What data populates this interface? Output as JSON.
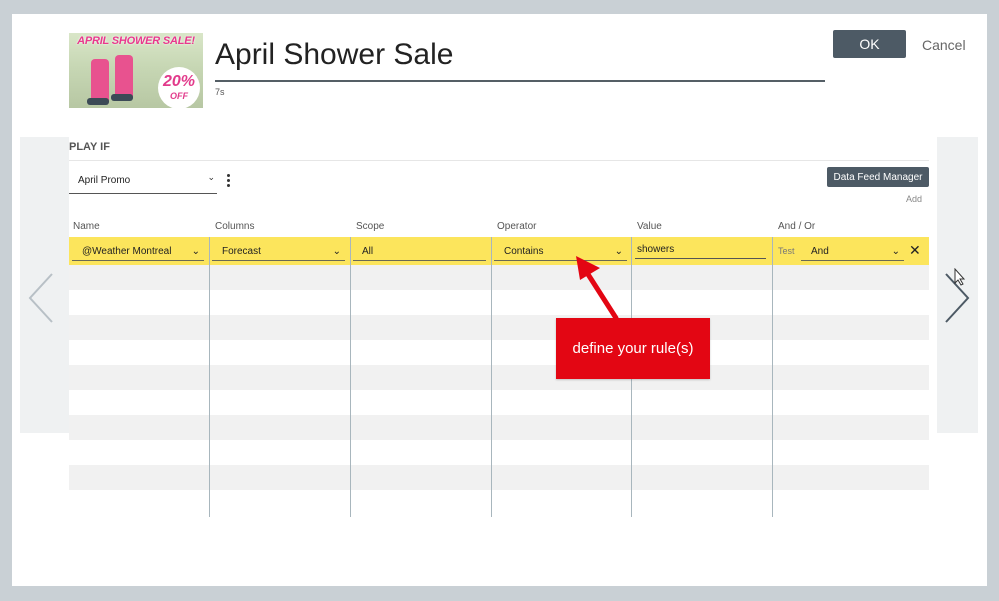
{
  "dialog": {
    "title": "April Shower Sale",
    "duration": "7s",
    "ok_label": "OK",
    "cancel_label": "Cancel",
    "thumbnail": {
      "banner_text": "APRIL SHOWER SALE!",
      "badge_percent": "20%",
      "badge_off": "OFF"
    }
  },
  "play_if": {
    "section_title": "PLAY IF",
    "promo_select": "April Promo",
    "data_feed_button": "Data Feed Manager",
    "add_link": "Add",
    "columns": [
      "Name",
      "Columns",
      "Scope",
      "Operator",
      "Value",
      "And / Or"
    ],
    "rule": {
      "name": "@Weather Montreal",
      "column": "Forecast",
      "scope": "All",
      "operator": "Contains",
      "value": "showers",
      "test_label": "Test",
      "and_or": "And",
      "remove_icon": "close-icon"
    }
  },
  "callout": {
    "text": "define your rule(s)",
    "color": "#e30613"
  },
  "colors": {
    "button": "#4d5a65",
    "highlight_row": "#fce55c",
    "panel": "#eff1f2"
  }
}
